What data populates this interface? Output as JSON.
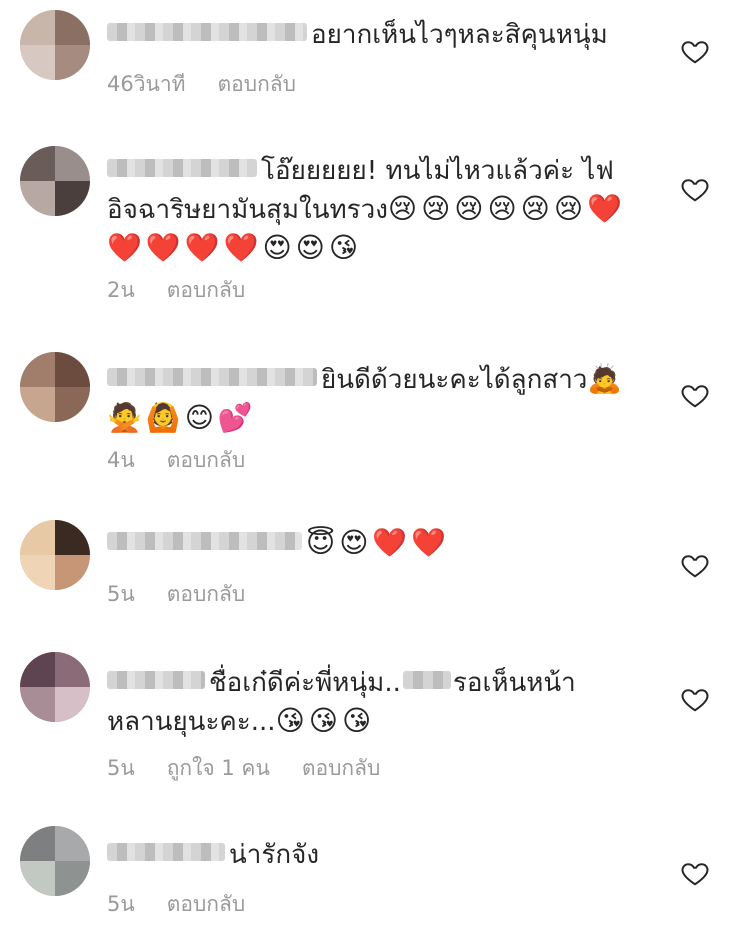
{
  "comments": [
    {
      "text": "อยากเห็นไวๆหละสิคุนหนุ่ม",
      "emojis": "",
      "time": "46วินาที",
      "likes": "",
      "reply": "ตอบกลับ"
    },
    {
      "text": "โอ๊ยยยยย! ทนไม่ไหวแล้วค่ะ ไฟอิจฉาริษยามันสุมในทรวง",
      "emojis": "😢😢😢😢😢😢❤️❤️❤️❤️❤️😍😍😘",
      "time": "2น",
      "likes": "",
      "reply": "ตอบกลับ"
    },
    {
      "text": "ยินดีด้วยนะคะได้ลูกสาว",
      "emojis": "🙇🙅🙆😊💕",
      "time": "4น",
      "likes": "",
      "reply": "ตอบกลับ"
    },
    {
      "text": "",
      "emojis": "😇😍❤️❤️",
      "time": "5น",
      "likes": "",
      "reply": "ตอบกลับ"
    },
    {
      "text_a": "ชื่อเก๋ดีค่ะพี่หนุ่ม..",
      "text_b": "รอเห็นหน้าหลานยุนะคะ...",
      "emojis": "😘😘😘",
      "time": "5น",
      "likes": "ถูกใจ 1 คน",
      "reply": "ตอบกลับ"
    },
    {
      "text": "น่ารักจัง",
      "emojis": "",
      "time": "5น",
      "likes": "",
      "reply": "ตอบกลับ"
    }
  ],
  "icons": {
    "like": "heart-outline-icon"
  },
  "colors": {
    "text": "#262626",
    "meta": "#9a9a9a",
    "icon": "#262626"
  }
}
